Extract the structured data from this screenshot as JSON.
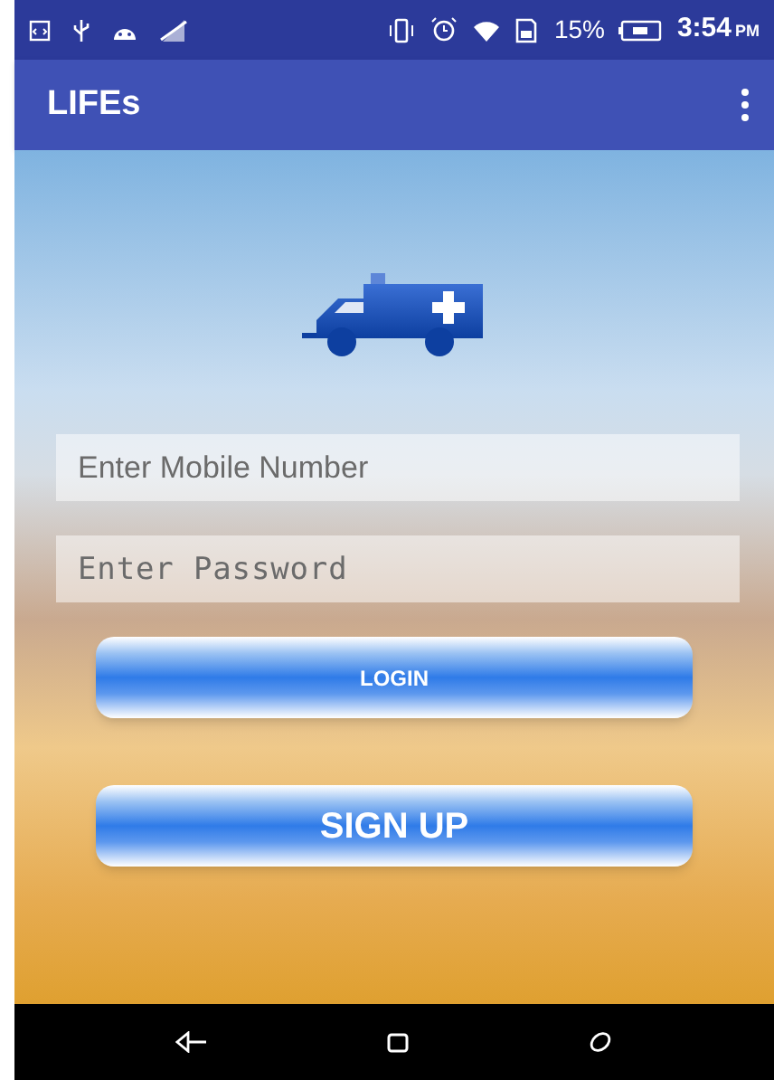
{
  "status_bar": {
    "battery": "15%",
    "time": "3:54",
    "meridiem": "PM"
  },
  "app_bar": {
    "title": "LIFEs"
  },
  "form": {
    "fields": [
      {
        "placeholder": "Enter Mobile Number",
        "kind": "text"
      },
      {
        "placeholder": "Enter Password",
        "kind": "password"
      }
    ],
    "buttons": [
      {
        "label": "LOGIN",
        "kind": "small"
      },
      {
        "label": "SIGN UP",
        "kind": "large"
      }
    ]
  }
}
